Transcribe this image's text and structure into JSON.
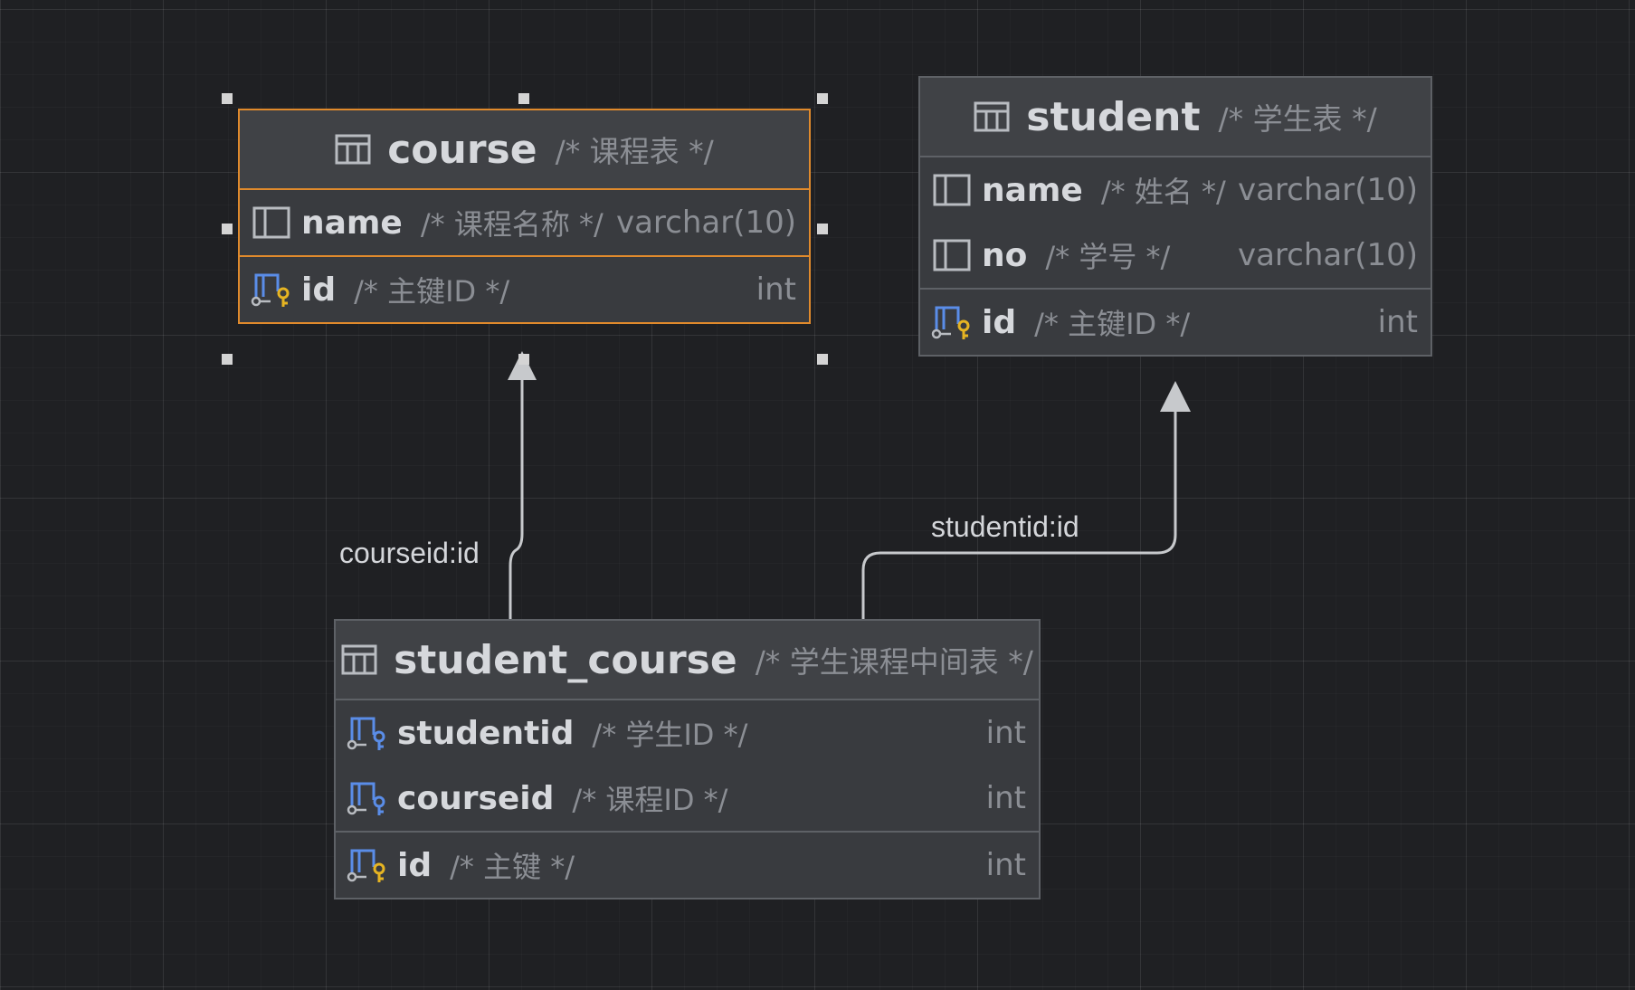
{
  "tables": {
    "course": {
      "name": "course",
      "comment": "/* 课程表 */",
      "columns": [
        {
          "name": "name",
          "comment": "/* 课程名称 */",
          "type": "varchar(10)",
          "icon": "column-icon"
        }
      ],
      "keys": [
        {
          "name": "id",
          "comment": "/* 主键ID */",
          "type": "int",
          "icon": "primary-key-icon"
        }
      ]
    },
    "student": {
      "name": "student",
      "comment": "/*  学生表 */",
      "columns": [
        {
          "name": "name",
          "comment": "/* 姓名 */",
          "type": "varchar(10)",
          "icon": "column-icon"
        },
        {
          "name": "no",
          "comment": "/* 学号 */",
          "type": "varchar(10)",
          "icon": "column-icon"
        }
      ],
      "keys": [
        {
          "name": "id",
          "comment": "/* 主键ID */",
          "type": "int",
          "icon": "primary-key-icon"
        }
      ]
    },
    "student_course": {
      "name": "student_course",
      "comment": "/* 学生课程中间表 */",
      "columns": [
        {
          "name": "studentid",
          "comment": "/* 学生ID */",
          "type": "int",
          "icon": "foreign-key-icon"
        },
        {
          "name": "courseid",
          "comment": "/* 课程ID */",
          "type": "int",
          "icon": "foreign-key-icon"
        }
      ],
      "keys": [
        {
          "name": "id",
          "comment": "/* 主键 */",
          "type": "int",
          "icon": "primary-key-icon"
        }
      ]
    }
  },
  "relations": {
    "courseid": "courseid:id",
    "studentid": "studentid:id"
  },
  "colors": {
    "selection": "#e08a2c",
    "key_gold": "#e6b422",
    "foreign_blue": "#5a8de8"
  }
}
